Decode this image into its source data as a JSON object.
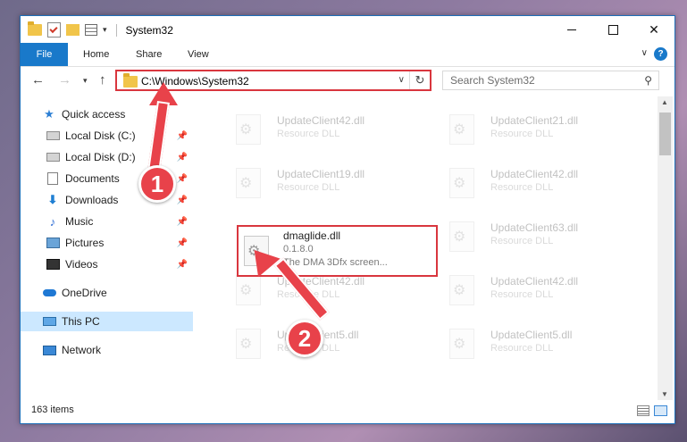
{
  "window": {
    "title": "System32",
    "controls": {
      "minimize": "minimize",
      "maximize": "maximize",
      "close": "✕"
    }
  },
  "ribbon": {
    "tabs": [
      "File",
      "Home",
      "Share",
      "View"
    ],
    "help": "?"
  },
  "address": {
    "path": "C:\\Windows\\System32",
    "search_placeholder": "Search System32"
  },
  "sidebar": {
    "items": [
      {
        "label": "Quick access",
        "icon": "star-icon"
      },
      {
        "label": "Local Disk (C:)",
        "icon": "disk-icon",
        "pinned": true
      },
      {
        "label": "Local Disk (D:)",
        "icon": "disk-icon",
        "pinned": true
      },
      {
        "label": "Documents",
        "icon": "documents-icon",
        "pinned": true
      },
      {
        "label": "Downloads",
        "icon": "download-icon",
        "pinned": true
      },
      {
        "label": "Music",
        "icon": "music-icon",
        "pinned": true
      },
      {
        "label": "Pictures",
        "icon": "pictures-icon",
        "pinned": true
      },
      {
        "label": "Videos",
        "icon": "videos-icon",
        "pinned": true
      },
      {
        "label": "OneDrive",
        "icon": "onedrive-icon"
      },
      {
        "label": "This PC",
        "icon": "pc-icon",
        "selected": true
      },
      {
        "label": "Network",
        "icon": "network-icon"
      }
    ]
  },
  "files": {
    "left": [
      {
        "name": "UpdateClient42.dll",
        "desc": "Resource DLL"
      },
      {
        "name": "UpdateClient19.dll",
        "desc": "Resource DLL"
      },
      {
        "name": "UpdateClient42.dll",
        "desc": "Resource DLL"
      },
      {
        "name": "UpdateClient5.dll",
        "desc": "Resource DLL"
      }
    ],
    "right": [
      {
        "name": "UpdateClient21.dll",
        "desc": "Resource DLL"
      },
      {
        "name": "UpdateClient42.dll",
        "desc": "Resource DLL"
      },
      {
        "name": "UpdateClient63.dll",
        "desc": "Resource DLL"
      },
      {
        "name": "UpdateClient42.dll",
        "desc": "Resource DLL"
      },
      {
        "name": "UpdateClient5.dll",
        "desc": "Resource DLL"
      }
    ],
    "highlighted": {
      "name": "dmaglide.dll",
      "version": "0.1.8.0",
      "desc": "The DMA 3Dfx screen..."
    }
  },
  "status": {
    "item_count": "163 items"
  },
  "callouts": [
    "1",
    "2"
  ],
  "colors": {
    "accent": "#1979ca",
    "callout": "#e8424a",
    "highlight_border": "#d9363e"
  }
}
